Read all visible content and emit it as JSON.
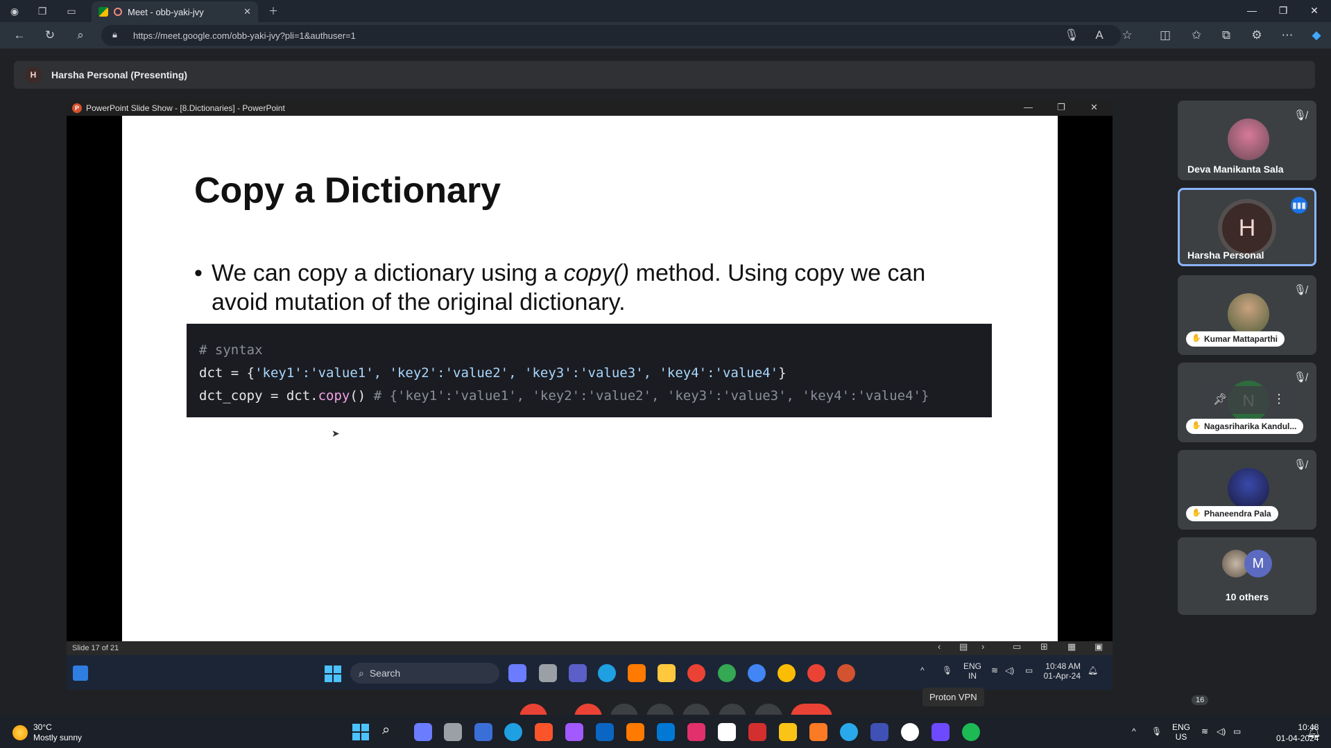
{
  "browser": {
    "tab_title": "Meet - obb-yaki-jvy",
    "url": "https://meet.google.com/obb-yaki-jvy?pli=1&authuser=1"
  },
  "meet": {
    "presenter_initial": "H",
    "presenter_label": "Harsha Personal (Presenting)",
    "participants": [
      {
        "name": "Deva Manikanta Sala"
      },
      {
        "initial": "H",
        "name": "Harsha Personal"
      },
      {
        "name": "Kumar Mattaparthi"
      },
      {
        "initial": "N",
        "name": "Nagasriharika Kandul..."
      },
      {
        "name": "Phaneendra Pala"
      },
      {
        "initial": "M",
        "name": "10 others"
      }
    ],
    "people_count": "16",
    "tooltip": "Proton VPN"
  },
  "ppt": {
    "window_title": "PowerPoint Slide Show - [8.Dictionaries] - PowerPoint",
    "slide_status": "Slide 17 of 21",
    "slide": {
      "title": "Copy a Dictionary",
      "bullet_pre": "We can copy a dictionary using a ",
      "bullet_em": "copy()",
      "bullet_post": " method. Using copy we can avoid mutation of the original dictionary.",
      "code_line1": "# syntax",
      "code_line2_a": "dct = {",
      "code_line2_b": "'key1':'value1', 'key2':'value2', 'key3':'value3', 'key4':'value4'",
      "code_line2_c": "}",
      "code_line3_a": "dct_copy = dct.",
      "code_line3_fn": "copy",
      "code_line3_b": "() ",
      "code_line3_comment": "# {'key1':'value1', 'key2':'value2', 'key3':'value3', 'key4':'value4'}"
    }
  },
  "inner_taskbar": {
    "search": "Search",
    "lang": "ENG",
    "region": "IN",
    "time": "10:48 AM",
    "date": "01-Apr-24"
  },
  "taskbar": {
    "temp": "30°C",
    "weather": "Mostly sunny",
    "lang": "ENG",
    "region": "US",
    "time": "10:48",
    "date": "01-04-2024"
  }
}
